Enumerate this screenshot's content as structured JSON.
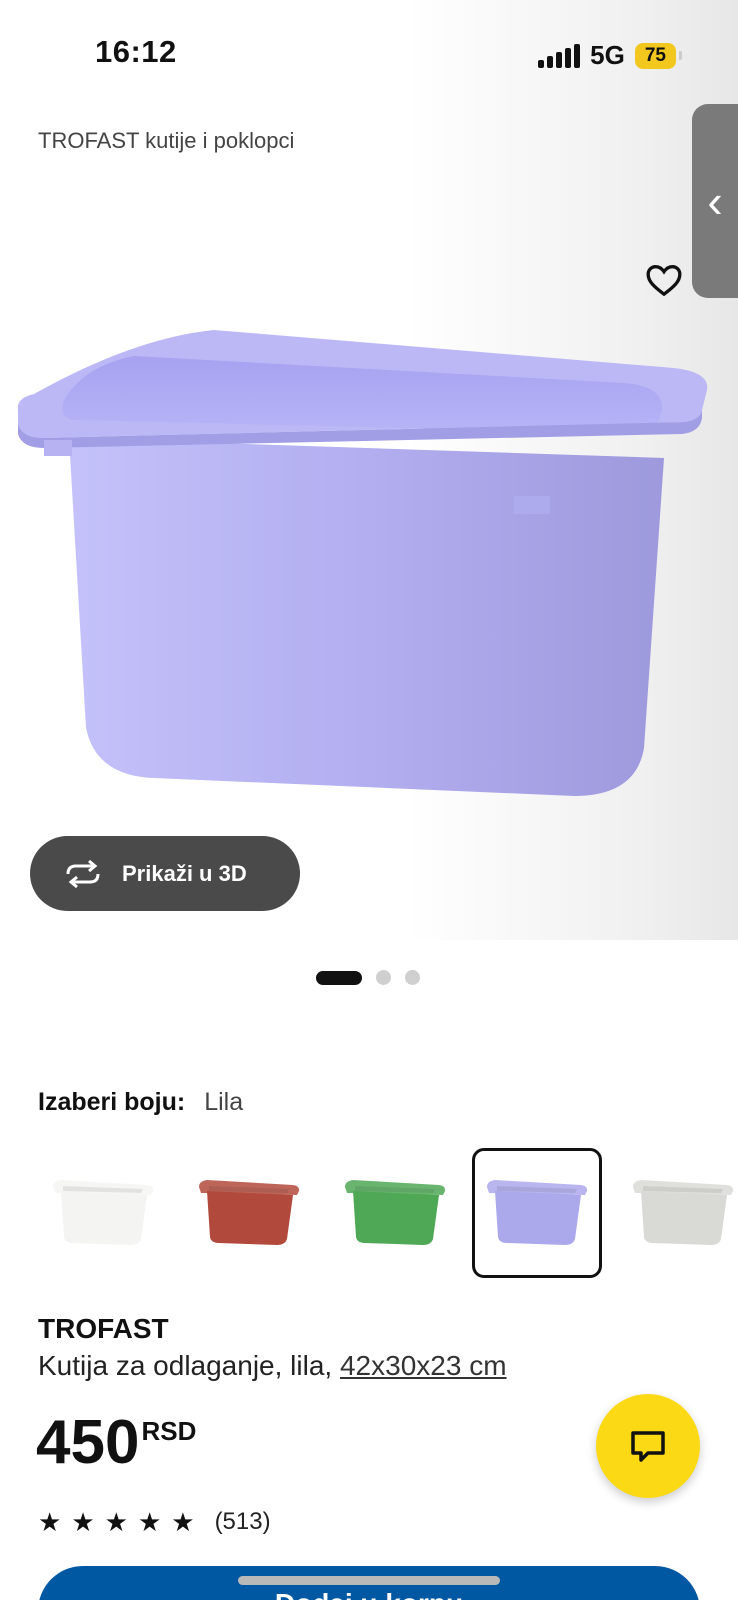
{
  "status": {
    "time": "16:12",
    "network": "5G",
    "battery": "75"
  },
  "breadcrumb": "TROFAST kutije i poklopci",
  "hero": {
    "view_3d_label": "Prikaži u 3D",
    "image_count": 3,
    "active_image": 1
  },
  "color": {
    "label": "Izaberi boju:",
    "selected": "Lila",
    "options": [
      {
        "name": "white",
        "fill": "#f4f4f2"
      },
      {
        "name": "red",
        "fill": "#b14a3c"
      },
      {
        "name": "green",
        "fill": "#4fa856"
      },
      {
        "name": "lilac",
        "fill": "#aba8ec"
      },
      {
        "name": "grey",
        "fill": "#d9d9d6"
      }
    ]
  },
  "product": {
    "name": "TROFAST",
    "description": "Kutija za odlaganje, lila, ",
    "dimensions": "42x30x23 cm",
    "price": "450",
    "currency": "RSD",
    "rating": 5,
    "review_count": "(513)"
  },
  "cart": {
    "label": "Dodaj u korpu"
  },
  "colors": {
    "accent": "#0058a3",
    "chat": "#fbd914",
    "box": "#aeaaf2"
  }
}
